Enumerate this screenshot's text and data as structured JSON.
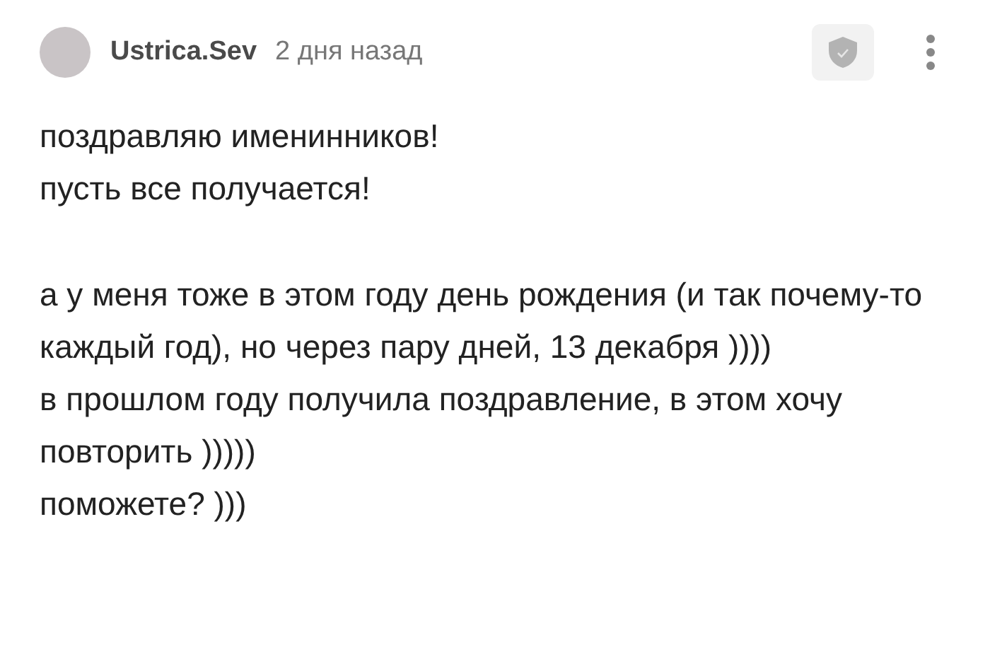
{
  "comment": {
    "author": "Ustrica.Sev",
    "time": "2 дня назад",
    "paragraphs": [
      [
        "поздравляю именинников!",
        "пусть все получается!"
      ],
      [
        "а у меня тоже в этом году день рождения (и так почему-то каждый год), но через пару дней, 13 декабря ))))",
        "в прошлом году получила поздравление, в этом хочу повторить )))))",
        "поможете? )))"
      ]
    ]
  }
}
